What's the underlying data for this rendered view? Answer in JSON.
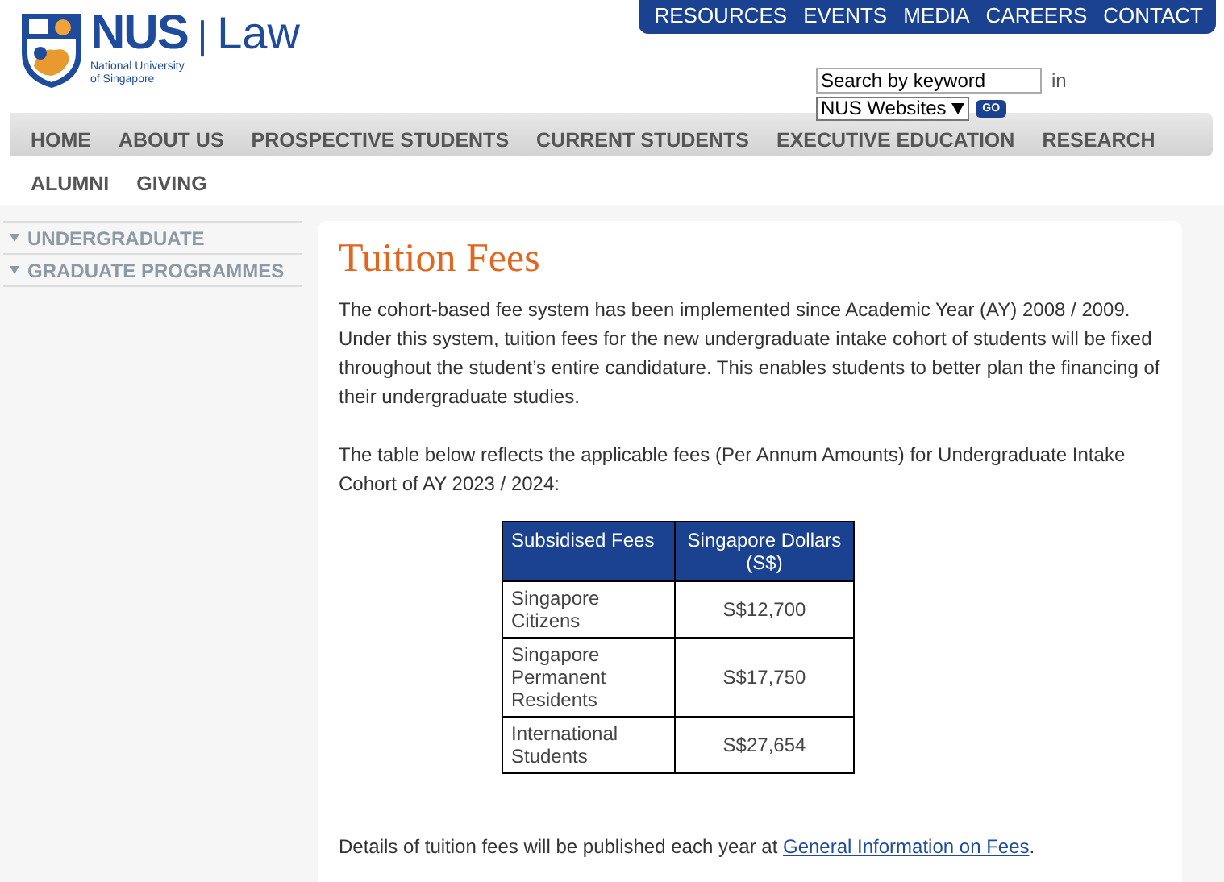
{
  "logo": {
    "mark": "NUS",
    "divider": "|",
    "unit": "Law",
    "line1": "National University",
    "line2": "of Singapore"
  },
  "utility_nav": [
    "RESOURCES",
    "EVENTS",
    "MEDIA",
    "CAREERS",
    "CONTACT"
  ],
  "search": {
    "placeholder": "Search by keyword",
    "in_label": "in",
    "scope": "NUS Websites",
    "go": "GO"
  },
  "main_nav": [
    "HOME",
    "ABOUT US",
    "PROSPECTIVE STUDENTS",
    "CURRENT STUDENTS",
    "EXECUTIVE EDUCATION",
    "RESEARCH"
  ],
  "main_nav_row2": [
    "ALUMNI",
    "GIVING"
  ],
  "sidebar": {
    "items": [
      {
        "label": "UNDERGRADUATE"
      },
      {
        "label": "GRADUATE PROGRAMMES"
      }
    ]
  },
  "content": {
    "title": "Tuition Fees",
    "paragraphs": [
      "The cohort-based fee system has been implemented since Academic Year (AY) 2008 / 2009. Under this system, tuition fees for the new undergraduate intake cohort of students will be fixed throughout the student’s entire candidature. This enables students to better plan the financing of their undergraduate studies.",
      "The table below reflects the applicable fees (Per Annum Amounts) for Undergraduate Intake Cohort of AY 2023 / 2024:"
    ],
    "table": {
      "columns": [
        "Subsidised Fees",
        "Singapore Dollars (S$)"
      ],
      "rows": [
        [
          "Singapore Citizens",
          "S$12,700"
        ],
        [
          "Singapore Permanent Residents",
          "S$17,750"
        ],
        [
          "International Students",
          "S$27,654"
        ]
      ]
    },
    "footer_text": "Details of tuition fees will be published each year at ",
    "footer_link": "General Information on Fees",
    "footer_end": "."
  }
}
